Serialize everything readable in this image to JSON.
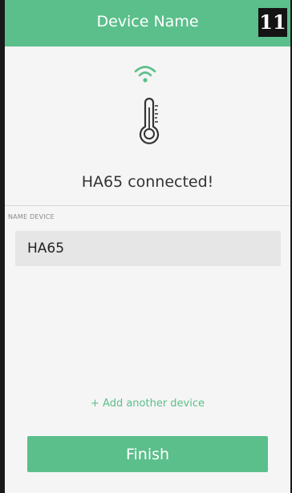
{
  "header": {
    "title": "Device Name",
    "page_badge": "11"
  },
  "device": {
    "icons": [
      "wifi-icon",
      "thermometer-icon"
    ],
    "status_text": "HA65 connected!"
  },
  "form": {
    "name_label": "NAME DEVICE",
    "name_value": "HA65"
  },
  "actions": {
    "add_another": "+ Add another device",
    "finish_label": "Finish"
  },
  "colors": {
    "accent": "#5bbf8b",
    "background": "#f5f5f5",
    "field_background": "#e6e6e6",
    "text": "#333333"
  }
}
